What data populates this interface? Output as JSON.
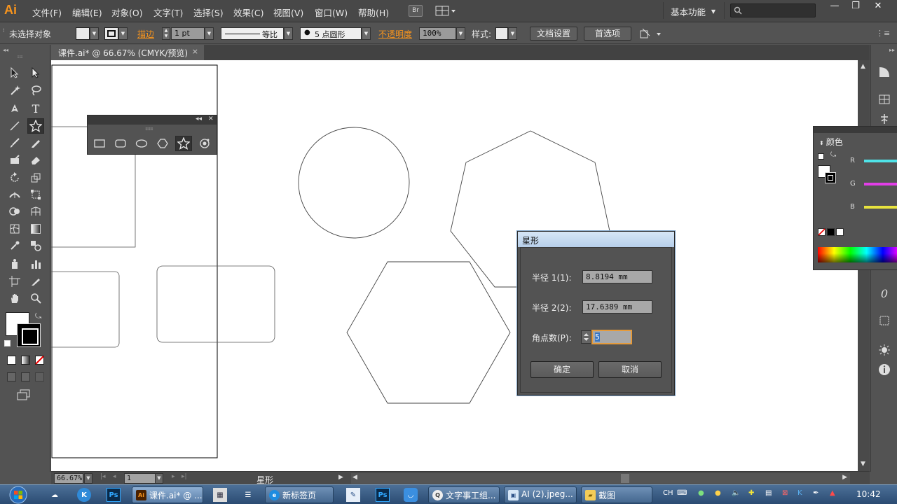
{
  "menubar": {
    "logo": "Ai",
    "items": [
      "文件(F)",
      "编辑(E)",
      "对象(O)",
      "文字(T)",
      "选择(S)",
      "效果(C)",
      "视图(V)",
      "窗口(W)",
      "帮助(H)"
    ],
    "bridge_label": "Br",
    "workspace": "基本功能",
    "window_controls": [
      "—",
      "❐",
      "✕"
    ]
  },
  "controlbar": {
    "selection_status": "未选择对象",
    "stroke_label": "描边",
    "stroke_weight": "1 pt",
    "stroke_profile": "等比",
    "brush": "5 点圆形",
    "opacity_label": "不透明度",
    "opacity_value": "100%",
    "style_label": "样式:",
    "doc_setup_button": "文档设置",
    "preferences_button": "首选项"
  },
  "document": {
    "tab_title": "课件.ai* @ 66.67% (CMYK/预览)",
    "tab_close": "×"
  },
  "star_dialog": {
    "title": "星形",
    "radius1_label": "半径 1(1):",
    "radius1_value": "8.8194 mm",
    "radius2_label": "半径 2(2):",
    "radius2_value": "17.6389 mm",
    "points_label": "角点数(P):",
    "points_value": "5",
    "ok_button": "确定",
    "cancel_button": "取消"
  },
  "color_panel": {
    "title": "颜色",
    "channels": [
      {
        "label": "R",
        "color": "#4fe3e8"
      },
      {
        "label": "G",
        "color": "#e23ee8"
      },
      {
        "label": "B",
        "color": "#e8e33e"
      }
    ]
  },
  "statusbar": {
    "zoom": "66.67%",
    "artboard": "1",
    "current_tool": "星形"
  },
  "taskbar": {
    "buttons": [
      {
        "label": "课件.ai* @ ...",
        "icon": "Ai"
      },
      {
        "label": "新标签页",
        "icon": "e"
      },
      {
        "label": "文字事工组...",
        "icon": "Q"
      },
      {
        "label": "AI (2).jpeg...",
        "icon": "img"
      },
      {
        "label": "截图",
        "icon": "folder"
      }
    ],
    "tray_lang": "CH",
    "clock": "10:42"
  },
  "colors": {
    "accent_orange": "#f7941d",
    "panel_bg": "#535353",
    "canvas_bg": "#ffffff"
  }
}
